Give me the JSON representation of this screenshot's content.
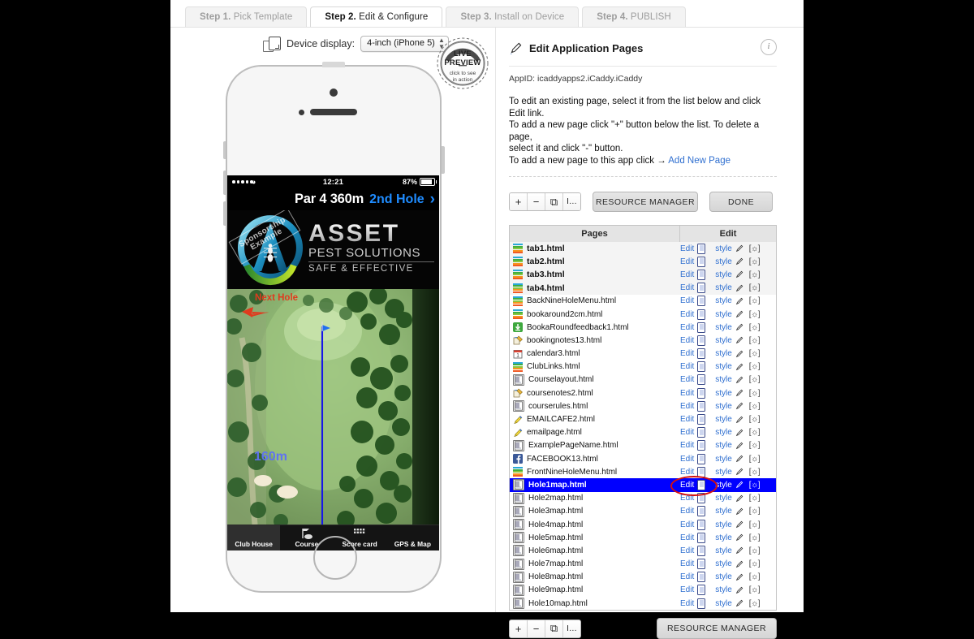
{
  "steps": [
    {
      "num": "Step 1.",
      "label": " Pick Template",
      "active": false
    },
    {
      "num": "Step 2.",
      "label": " Edit & Configure",
      "active": true
    },
    {
      "num": "Step 3.",
      "label": " Install on Device",
      "active": false
    },
    {
      "num": "Step 4.",
      "label": " PUBLISH",
      "active": false
    }
  ],
  "device": {
    "label": "Device display:",
    "selected": "4-inch (iPhone 5)"
  },
  "live_preview": {
    "line1": "LIVE",
    "line2": "PREVIEW",
    "sub1": "click to see",
    "sub2": "in action"
  },
  "phone": {
    "status": {
      "time": "12:21",
      "battery": "87%"
    },
    "nav": {
      "par": "Par 4 360m",
      "hole": "2nd Hole",
      "chevron": "›"
    },
    "banner": {
      "title": "ASSET",
      "sub": "PEST SOLUTIONS",
      "tagline": "SAFE & EFFECTIVE",
      "stamp": "Sponsorship Example"
    },
    "map": {
      "next_hole": "Next Hole",
      "distance": "160m"
    },
    "tabs": [
      {
        "label": "Club House",
        "active": true
      },
      {
        "label": "Course",
        "active": false
      },
      {
        "label": "Score card",
        "active": false
      },
      {
        "label": "GPS & Map",
        "active": false
      }
    ]
  },
  "panel": {
    "title": "Edit Application Pages",
    "info_glyph": "i",
    "appid": "AppID: icaddyapps2.iCaddy.iCaddy",
    "instructions_line1": "To edit an existing page, select it from the list below and click Edit link.",
    "instructions_line2": "To add a new page click \"+\" button below the list. To delete a page,",
    "instructions_line3": "select it and click \"-\" button.",
    "instructions_line4": "To add a new page to this app click → ",
    "add_new_page": "Add New Page",
    "mini_buttons": [
      "+",
      "−",
      "⧉",
      "I…"
    ],
    "resource_manager": "RESOURCE MANAGER",
    "done": "DONE",
    "columns": {
      "pages": "Pages",
      "edit": "Edit"
    },
    "actions": {
      "edit": "Edit",
      "style": "style",
      "gear": "[☼]"
    },
    "rows": [
      {
        "name": "tab1.html",
        "icon": "stripes",
        "bold": true,
        "selected": false
      },
      {
        "name": "tab2.html",
        "icon": "stripes",
        "bold": true,
        "selected": false
      },
      {
        "name": "tab3.html",
        "icon": "stripes",
        "bold": true,
        "selected": false
      },
      {
        "name": "tab4.html",
        "icon": "stripes",
        "bold": true,
        "selected": false
      },
      {
        "name": "BackNineHoleMenu.html",
        "icon": "stripes",
        "bold": false,
        "selected": false
      },
      {
        "name": "bookaround2cm.html",
        "icon": "stripes",
        "bold": false,
        "selected": false
      },
      {
        "name": "BookaRoundfeedback1.html",
        "icon": "green",
        "bold": false,
        "selected": false
      },
      {
        "name": "bookingnotes13.html",
        "icon": "book",
        "bold": false,
        "selected": false
      },
      {
        "name": "calendar3.html",
        "icon": "calendar",
        "bold": false,
        "selected": false
      },
      {
        "name": "ClubLinks.html",
        "icon": "stripes",
        "bold": false,
        "selected": false
      },
      {
        "name": "Courselayout.html",
        "icon": "doc",
        "bold": false,
        "selected": false
      },
      {
        "name": "coursenotes2.html",
        "icon": "book",
        "bold": false,
        "selected": false
      },
      {
        "name": "courserules.html",
        "icon": "doc",
        "bold": false,
        "selected": false
      },
      {
        "name": "EMAILCAFE2.html",
        "icon": "pencil",
        "bold": false,
        "selected": false
      },
      {
        "name": "emailpage.html",
        "icon": "pencil",
        "bold": false,
        "selected": false
      },
      {
        "name": "ExamplePageName.html",
        "icon": "doc",
        "bold": false,
        "selected": false
      },
      {
        "name": "FACEBOOK13.html",
        "icon": "facebook",
        "bold": false,
        "selected": false
      },
      {
        "name": "FrontNineHoleMenu.html",
        "icon": "stripes",
        "bold": false,
        "selected": false
      },
      {
        "name": "Hole1map.html",
        "icon": "doc",
        "bold": false,
        "selected": true
      },
      {
        "name": "Hole2map.html",
        "icon": "doc",
        "bold": false,
        "selected": false
      },
      {
        "name": "Hole3map.html",
        "icon": "doc",
        "bold": false,
        "selected": false
      },
      {
        "name": "Hole4map.html",
        "icon": "doc",
        "bold": false,
        "selected": false
      },
      {
        "name": "Hole5map.html",
        "icon": "doc",
        "bold": false,
        "selected": false
      },
      {
        "name": "Hole6map.html",
        "icon": "doc",
        "bold": false,
        "selected": false
      },
      {
        "name": "Hole7map.html",
        "icon": "doc",
        "bold": false,
        "selected": false
      },
      {
        "name": "Hole8map.html",
        "icon": "doc",
        "bold": false,
        "selected": false
      },
      {
        "name": "Hole9map.html",
        "icon": "doc",
        "bold": false,
        "selected": false
      },
      {
        "name": "Hole10map.html",
        "icon": "doc",
        "bold": false,
        "selected": false
      }
    ],
    "bottom_resource_manager": "RESOURCE MANAGER"
  },
  "colors": {
    "link": "#2f6fd0",
    "selection": "#0000ff",
    "annotation": "#d41010",
    "accent_blue": "#1f8cff"
  }
}
